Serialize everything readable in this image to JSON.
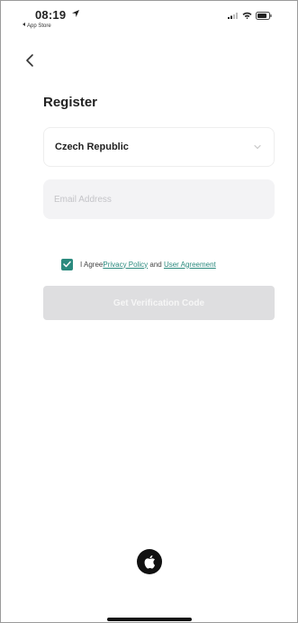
{
  "status_bar": {
    "time": "08:19",
    "back_app_label": "App Store",
    "icons": [
      "location-arrow-icon",
      "cellular-signal-icon",
      "wifi-icon",
      "battery-icon"
    ]
  },
  "header": {
    "back_icon": "chevron-left-icon",
    "title": "Register"
  },
  "form": {
    "country_value": "Czech Republic",
    "email_value": "",
    "email_placeholder": "Email Address",
    "agreement": {
      "checked": true,
      "prefix": "I Agree",
      "privacy_link": "Privacy Policy",
      "connector": " and ",
      "agreement_link": "User Agreement"
    },
    "submit_label": "Get Verification Code",
    "submit_enabled": false
  },
  "third_party_login": {
    "icon": "apple-logo-icon"
  },
  "colors": {
    "accent": "#2b8a7e",
    "disabled_button": "#dedee0",
    "input_background": "#f3f3f5"
  }
}
